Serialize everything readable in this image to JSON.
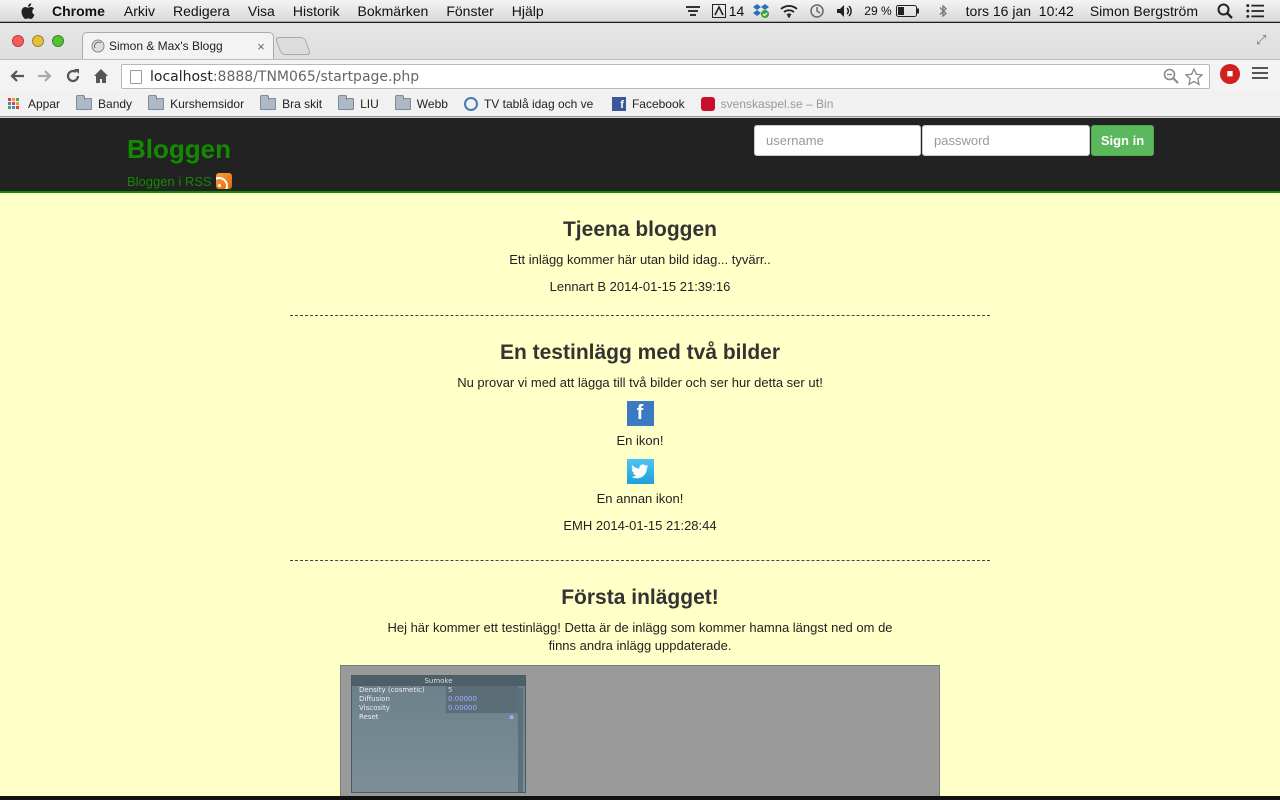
{
  "menubar": {
    "app": "Chrome",
    "menus": [
      "Arkiv",
      "Redigera",
      "Visa",
      "Historik",
      "Bokmärken",
      "Fönster",
      "Hjälp"
    ],
    "tray_count": "14",
    "battery": "29 %",
    "clock": "tors 16 jan  10:42",
    "user": "Simon Bergström"
  },
  "browser": {
    "tab_title": "Simon & Max's Blogg",
    "url_host": "localhost",
    "url_rest": ":8888/TNM065/startpage.php",
    "bookmarks": [
      {
        "label": "Appar",
        "icon": "apps-grid-icon"
      },
      {
        "label": "Bandy",
        "icon": "folder-icon"
      },
      {
        "label": "Kurshemsidor",
        "icon": "folder-icon"
      },
      {
        "label": "Bra skit",
        "icon": "folder-icon"
      },
      {
        "label": "LIU",
        "icon": "folder-icon"
      },
      {
        "label": "Webb",
        "icon": "folder-icon"
      },
      {
        "label": "TV tablå idag och ve",
        "icon": "tv-icon"
      },
      {
        "label": "Facebook",
        "icon": "facebook-icon"
      },
      {
        "label": "svenskaspel.se – Bin",
        "icon": "svenskaspel-icon"
      }
    ]
  },
  "site": {
    "title": "Bloggen",
    "rss_label": "Bloggen i RSS",
    "login": {
      "username_placeholder": "username",
      "password_placeholder": "password",
      "signin_label": "Sign in"
    }
  },
  "posts": [
    {
      "title": "Tjeena bloggen",
      "body": "Ett inlägg kommer här utan bild idag... tyvärr..",
      "meta": "Lennart B 2014-01-15 21:39:16"
    },
    {
      "title": "En testinlägg med två bilder",
      "body": "Nu provar vi med att lägga till två bilder och ser hur detta ser ut!",
      "caption1": "En ikon!",
      "caption2": "En annan ikon!",
      "meta": "EMH 2014-01-15 21:28:44"
    },
    {
      "title": "Första inlägget!",
      "body": "Hej här kommer ett testinlägg! Detta är de inlägg som kommer hamna längst ned om de finns andra inlägg uppdaterade.",
      "image_panel": {
        "title": "Sumoke",
        "rows": [
          {
            "label": "Density (cosmetic)",
            "value": "5"
          },
          {
            "label": "Diffusion",
            "value": "0.00000"
          },
          {
            "label": "Viscosity",
            "value": "0.00000"
          },
          {
            "label": "Reset",
            "value": ""
          }
        ]
      }
    }
  ],
  "colors": {
    "page_bg": "#ffffc8",
    "header_bg": "#222222",
    "brand_green": "#138a00",
    "signin_green": "#5cb85c"
  }
}
